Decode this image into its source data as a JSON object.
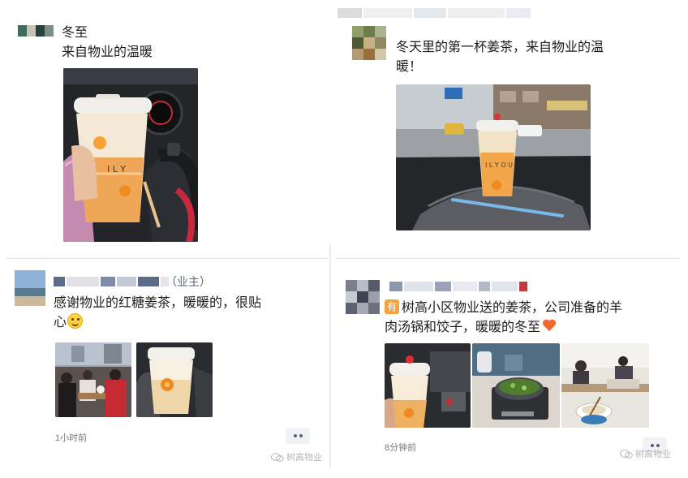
{
  "posts": [
    {
      "id": "post-1",
      "text_lines": [
        "冬至",
        "来自物业的温暖"
      ]
    },
    {
      "id": "post-2",
      "text_lines": [
        "冬天里的第一杯姜茶，来自物业的温",
        "暖！"
      ],
      "photo": {
        "cup_text": "I L Y O U"
      }
    },
    {
      "id": "post-3",
      "name": "（业主）",
      "text_lines": [
        "感谢物业的红糖姜茶，暖暖的，很贴",
        "心"
      ],
      "emoji": "smile-emoji",
      "time": "1小时前",
      "watermark": "树高物业"
    },
    {
      "id": "post-4",
      "badge": "有",
      "text_lines": [
        "树高小区物业送的姜茶，公司准备的羊",
        "肉汤锅和饺子，暖暖的冬至"
      ],
      "emoji": "orange-heart-emoji",
      "time": "8分钟前",
      "watermark": "树高物业"
    }
  ],
  "colors": {
    "tea_orange": "#eea24a",
    "heart_orange": "#f4672f",
    "badge_orange": "#f2a33b",
    "meta_gray": "#7a7a7a"
  }
}
